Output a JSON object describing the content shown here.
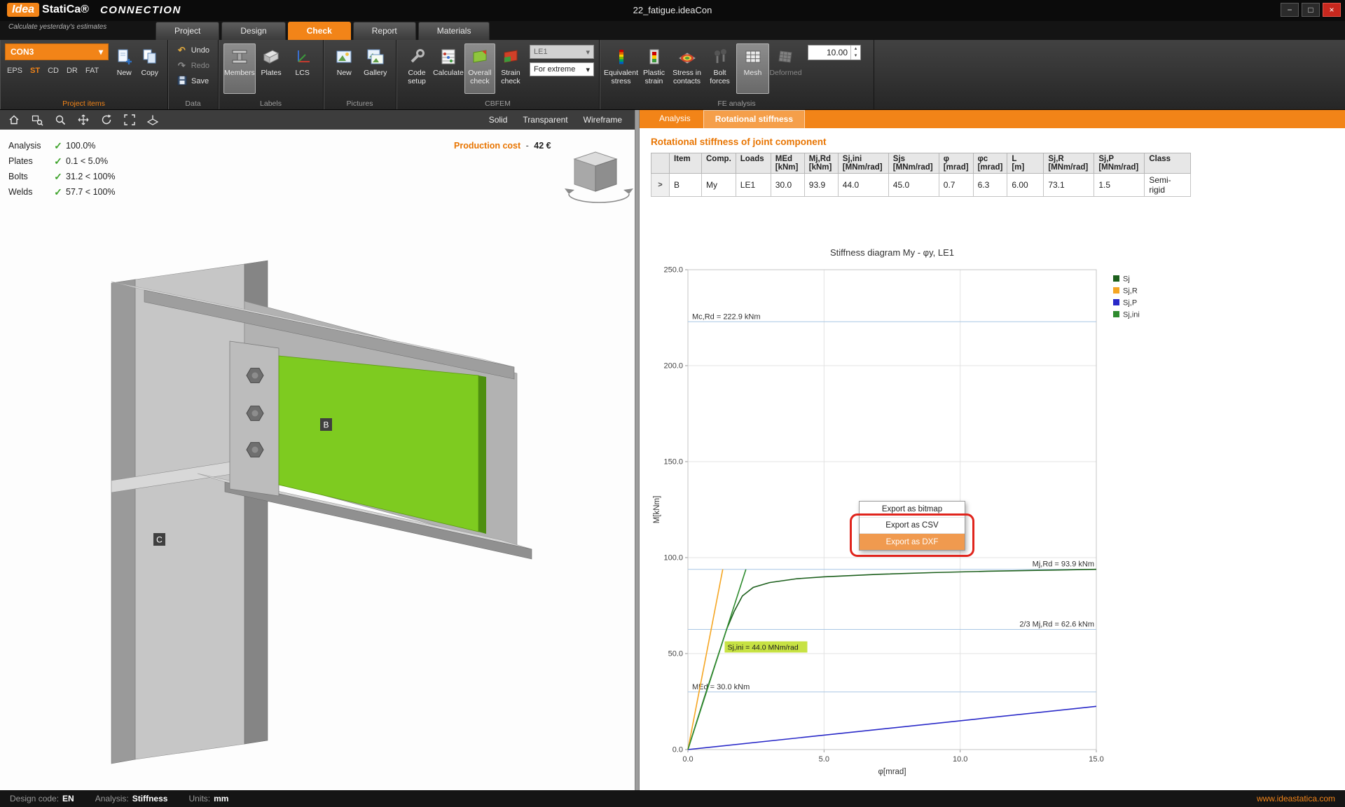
{
  "titlebar": {
    "logo_idea": "Idea",
    "logo_statica": "StatiCa®",
    "app_name": "CONNECTION",
    "tagline": "Calculate yesterday's estimates",
    "document_title": "22_fatigue.ideaCon"
  },
  "glyphs": {
    "dropdown": "▾",
    "spin_up": "▴",
    "spin_down": "▾",
    "check": "✓",
    "undo": "↶",
    "redo": "↷",
    "minimize": "−",
    "maximize": "□",
    "close": "×"
  },
  "ribbon": {
    "tabs": [
      {
        "label": "Project",
        "active": false
      },
      {
        "label": "Design",
        "active": false
      },
      {
        "label": "Check",
        "active": true
      },
      {
        "label": "Report",
        "active": false
      },
      {
        "label": "Materials",
        "active": false
      }
    ],
    "groups": {
      "project_items": {
        "label": "Project items",
        "selector": "CON3",
        "filters": [
          {
            "label": "EPS",
            "active": false
          },
          {
            "label": "ST",
            "active": true
          },
          {
            "label": "CD",
            "active": false
          },
          {
            "label": "DR",
            "active": false
          },
          {
            "label": "FAT",
            "active": false
          }
        ],
        "new_label": "New",
        "copy_label": "Copy"
      },
      "data": {
        "label": "Data",
        "buttons": [
          "Undo",
          "Redo",
          "Save"
        ]
      },
      "labels": {
        "label": "Labels",
        "buttons": [
          "Members",
          "Plates",
          "LCS"
        ],
        "active": "Members"
      },
      "pictures": {
        "label": "Pictures",
        "buttons": [
          "New",
          "Gallery"
        ]
      },
      "cbfem": {
        "label": "CBFEM",
        "buttons": [
          "Code setup",
          "Calculate",
          "Overall check",
          "Strain check"
        ],
        "active": "Overall check",
        "load_case": "LE1",
        "extreme": "For extreme"
      },
      "fe_analysis": {
        "label": "FE analysis",
        "buttons": [
          "Equivalent stress",
          "Plastic strain",
          "Stress in contacts",
          "Bolt forces",
          "Mesh",
          "Deformed"
        ],
        "active": "Mesh",
        "disabled": "Deformed",
        "scale_value": "10.00"
      }
    }
  },
  "viewport": {
    "view_modes": [
      "Solid",
      "Transparent",
      "Wireframe"
    ],
    "checks": [
      {
        "label": "Analysis",
        "value": "100.0%"
      },
      {
        "label": "Plates",
        "value": "0.1 < 5.0%"
      },
      {
        "label": "Bolts",
        "value": "31.2 < 100%"
      },
      {
        "label": "Welds",
        "value": "57.7 < 100%"
      }
    ],
    "production_cost_label": "Production cost",
    "production_cost_dash": "-",
    "production_cost_value": "42 €",
    "member_labels": {
      "beam": "B",
      "column": "C"
    }
  },
  "results_panel": {
    "tabs": [
      {
        "label": "Analysis",
        "active": false
      },
      {
        "label": "Rotational stiffness",
        "active": true
      }
    ],
    "heading": "Rotational stiffness of joint component",
    "table": {
      "columns": [
        {
          "name": "",
          "unit": ""
        },
        {
          "name": "Item",
          "unit": ""
        },
        {
          "name": "Comp.",
          "unit": ""
        },
        {
          "name": "Loads",
          "unit": ""
        },
        {
          "name": "MEd",
          "unit": "[kNm]"
        },
        {
          "name": "Mj,Rd",
          "unit": "[kNm]"
        },
        {
          "name": "Sj,ini",
          "unit": "[MNm/rad]"
        },
        {
          "name": "Sjs",
          "unit": "[MNm/rad]"
        },
        {
          "name": "φ",
          "unit": "[mrad]"
        },
        {
          "name": "φc",
          "unit": "[mrad]"
        },
        {
          "name": "L",
          "unit": "[m]"
        },
        {
          "name": "Sj,R",
          "unit": "[MNm/rad]"
        },
        {
          "name": "Sj,P",
          "unit": "[MNm/rad]"
        },
        {
          "name": "Class",
          "unit": ""
        }
      ],
      "rows": [
        [
          ">",
          "B",
          "My",
          "LE1",
          "30.0",
          "93.9",
          "44.0",
          "45.0",
          "0.7",
          "6.3",
          "6.00",
          "73.1",
          "1.5",
          "Semi-rigid"
        ]
      ]
    }
  },
  "chart_data": {
    "type": "line",
    "title": "Stiffness diagram My - φy, LE1",
    "xlabel": "φ[mrad]",
    "ylabel": "M[kNm]",
    "xlim": [
      0,
      15
    ],
    "ylim": [
      0,
      250
    ],
    "xticks": [
      0,
      5,
      10,
      15
    ],
    "yticks": [
      0,
      50,
      100,
      150,
      200,
      250
    ],
    "grid": true,
    "legend_position": "top-right",
    "series": [
      {
        "name": "Sj",
        "color": "#1c5f1c",
        "x": [
          0,
          0.3,
          0.6,
          0.9,
          1.2,
          1.42,
          1.7,
          2.0,
          2.4,
          3.0,
          4.0,
          5.0,
          7.0,
          9.0,
          11.0,
          13.0,
          15.0
        ],
        "y": [
          0,
          13.5,
          27.0,
          40.0,
          53.0,
          62.6,
          72.0,
          80.0,
          84.5,
          87.0,
          89.0,
          90.0,
          91.3,
          92.2,
          92.9,
          93.4,
          93.9
        ]
      },
      {
        "name": "Sj,R",
        "color": "#f5a623",
        "x": [
          0,
          1.28
        ],
        "y": [
          0,
          93.9
        ]
      },
      {
        "name": "Sj,P",
        "color": "#2929c8",
        "x": [
          0,
          15
        ],
        "y": [
          0,
          22.5
        ]
      },
      {
        "name": "Sj,ini",
        "color": "#2e8b2e",
        "x": [
          0,
          2.13
        ],
        "y": [
          0,
          93.9
        ]
      }
    ],
    "reference_lines": [
      {
        "label": "Mc,Rd = 222.9 kNm",
        "value": 222.9,
        "label_side": "left"
      },
      {
        "label": "Mj,Rd = 93.9 kNm",
        "value": 93.9,
        "label_side": "right"
      },
      {
        "label": "2/3 Mj,Rd = 62.6 kNm",
        "value": 62.6,
        "label_side": "right"
      },
      {
        "label": "MEd = 30.0 kNm",
        "value": 30.0,
        "label_side": "left"
      }
    ],
    "annotations": [
      {
        "text": "Sj,ini = 44.0 MNm/rad",
        "x": 1.35,
        "y": 52,
        "highlight": "#c7e243"
      }
    ]
  },
  "context_menu": {
    "items": [
      {
        "label": "Export as bitmap",
        "highlighted": false
      },
      {
        "label": "Export as CSV",
        "highlighted": false
      },
      {
        "label": "Export as DXF",
        "highlighted": true
      }
    ]
  },
  "statusbar": {
    "items": [
      {
        "label": "Design code:",
        "value": "EN"
      },
      {
        "label": "Analysis:",
        "value": "Stiffness"
      },
      {
        "label": "Units:",
        "value": "mm"
      }
    ],
    "website": "www.ideastatica.com"
  },
  "colors": {
    "accent": "#F28418",
    "heading_orange": "#E87400",
    "plate_green": "#7ECB20",
    "check_green": "#3FA32C",
    "menu_highlight": "#F09A4F",
    "annotation_red": "#E0241C",
    "annotation_highlight": "#C7E243"
  }
}
